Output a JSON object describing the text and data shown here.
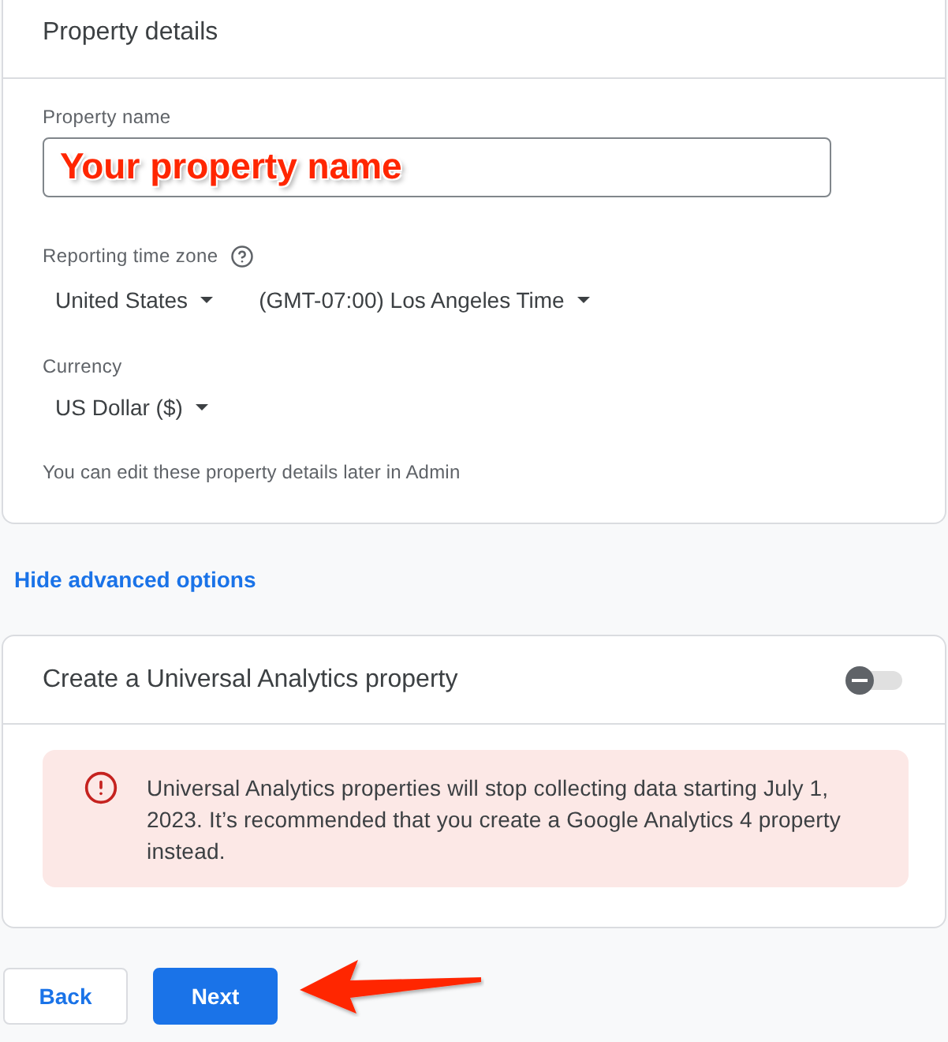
{
  "details": {
    "title": "Property details",
    "property_name": {
      "label": "Property name",
      "annotation": "Your property name"
    },
    "time_zone": {
      "label": "Reporting time zone",
      "country": "United States",
      "zone": "(GMT-07:00) Los Angeles Time"
    },
    "currency": {
      "label": "Currency",
      "value": "US Dollar ($)"
    },
    "note": "You can edit these property details later in Admin"
  },
  "advanced_link": "Hide advanced options",
  "universal": {
    "title": "Create a Universal Analytics property",
    "on": false,
    "warning": "Universal Analytics properties will stop collecting data starting July 1, 2023. It’s recommended that you create a Google Analytics 4 property instead."
  },
  "buttons": [
    {
      "label": "Back",
      "kind": "secondary"
    },
    {
      "label": "Next",
      "kind": "primary"
    }
  ]
}
